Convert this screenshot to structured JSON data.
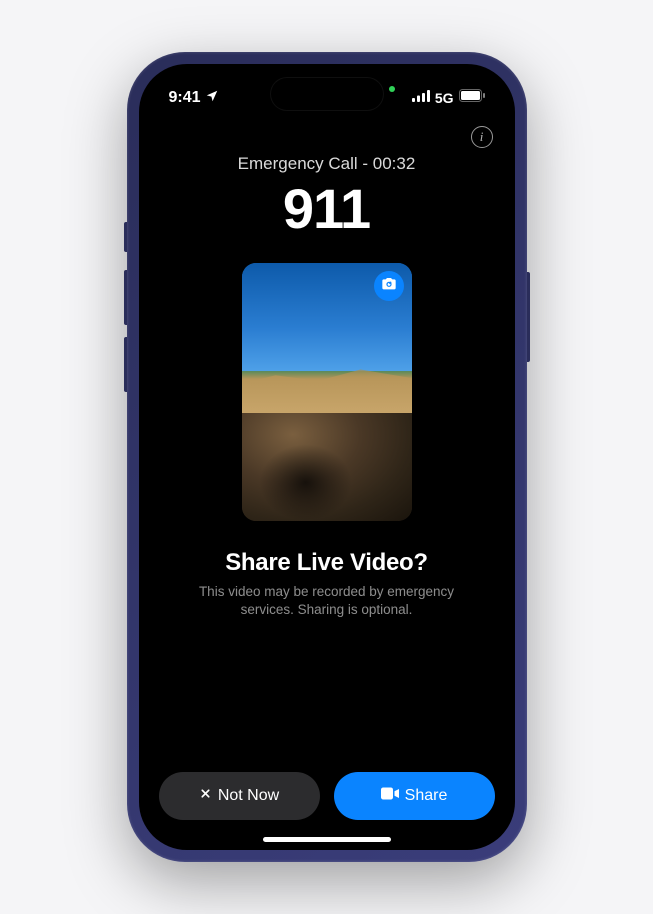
{
  "statusBar": {
    "time": "9:41",
    "network": "5G"
  },
  "call": {
    "statusLabel": "Emergency Call - 00:32",
    "number": "911"
  },
  "prompt": {
    "title": "Share Live Video?",
    "subtitle": "This video may be recorded by emergency services. Sharing is optional."
  },
  "buttons": {
    "notNow": "Not Now",
    "share": "Share"
  },
  "icons": {
    "info": "i"
  }
}
